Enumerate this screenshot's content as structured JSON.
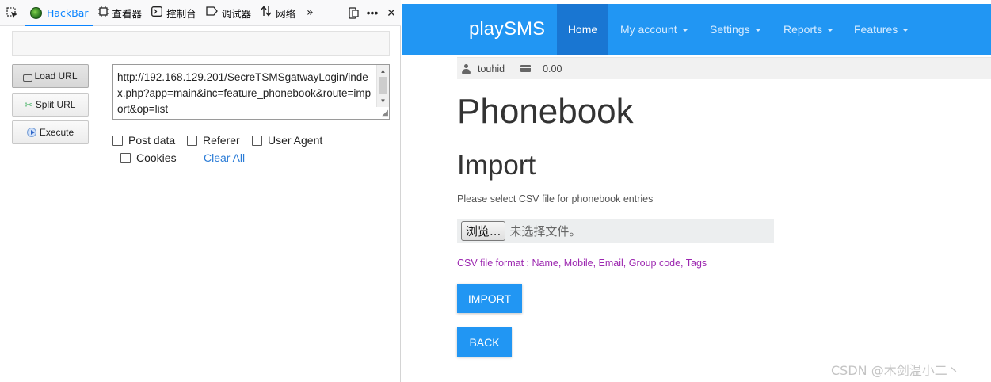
{
  "devtools": {
    "tabs": [
      {
        "label": "HackBar",
        "icon": "hackbar-logo-icon"
      },
      {
        "label": "查看器",
        "icon": "inspector-icon"
      },
      {
        "label": "控制台",
        "icon": "console-icon"
      },
      {
        "label": "调试器",
        "icon": "debugger-icon"
      },
      {
        "label": "网络",
        "icon": "network-icon"
      }
    ],
    "active_tab": "HackBar",
    "accent_color": "#0a84ff"
  },
  "hackbar": {
    "buttons": {
      "load_url": "Load URL",
      "split_url": "Split URL",
      "execute": "Execute"
    },
    "url": "http://192.168.129.201/SecreTSMSgatwayLogin/index.php?app=main&inc=feature_phonebook&route=import&op=list",
    "options": {
      "post_data": "Post data",
      "referer": "Referer",
      "user_agent": "User Agent",
      "cookies": "Cookies",
      "clear_all": "Clear All"
    }
  },
  "site": {
    "brand": "playSMS",
    "nav": {
      "home": "Home",
      "my_account": "My account",
      "settings": "Settings",
      "reports": "Reports",
      "features": "Features"
    },
    "primary_color": "#2196f3",
    "user": {
      "username": "touhid",
      "credit": "0.00"
    }
  },
  "content": {
    "title": "Phonebook",
    "subtitle": "Import",
    "instructions": "Please select CSV file for phonebook entries",
    "file_button": "浏览...",
    "file_status": "未选择文件。",
    "csv_format": "CSV file format : Name, Mobile, Email, Group code, Tags",
    "import_button": "IMPORT",
    "back_button": "BACK"
  },
  "watermark": "CSDN @木剑温小二丶"
}
